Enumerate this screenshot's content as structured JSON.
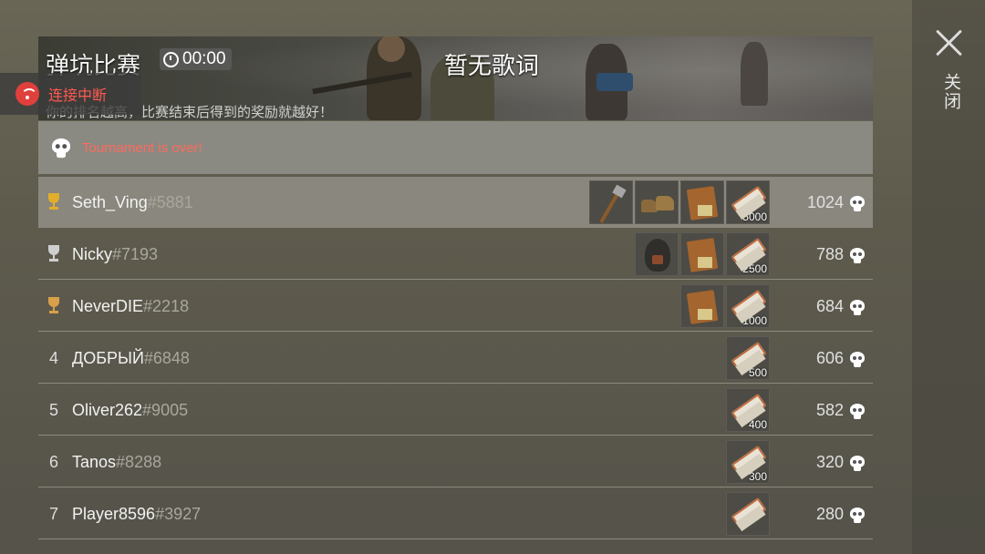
{
  "header": {
    "title": "弹坑比赛",
    "timer": "00:00",
    "lyrics": "暂无歌词",
    "subtitle": "你的排名越高，比赛结束后得到的奖励就越好！"
  },
  "connection": {
    "label": "连接中断"
  },
  "close": {
    "label": "关闭"
  },
  "notice": {
    "text": "Tournament is over!"
  },
  "players": [
    {
      "rank": "",
      "trophy": "gold",
      "name": "Seth_Ving",
      "tag": "#5881",
      "score": "1024",
      "rewards": [
        {
          "item": "axe",
          "qty": ""
        },
        {
          "item": "boots",
          "qty": ""
        },
        {
          "item": "mre",
          "qty": ""
        },
        {
          "item": "ticket",
          "qty": "5000"
        }
      ]
    },
    {
      "rank": "",
      "trophy": "silver",
      "name": "Nicky",
      "tag": "#7193",
      "score": "788",
      "rewards": [
        {
          "item": "mask",
          "qty": ""
        },
        {
          "item": "mre",
          "qty": ""
        },
        {
          "item": "ticket",
          "qty": "2500"
        }
      ]
    },
    {
      "rank": "",
      "trophy": "bronze",
      "name": "NeverDIE",
      "tag": "#2218",
      "score": "684",
      "rewards": [
        {
          "item": "mre",
          "qty": ""
        },
        {
          "item": "ticket",
          "qty": "1000"
        }
      ]
    },
    {
      "rank": "4",
      "trophy": "",
      "name": "ДОБРЫЙ",
      "tag": "#6848",
      "score": "606",
      "rewards": [
        {
          "item": "ticket",
          "qty": "500"
        }
      ]
    },
    {
      "rank": "5",
      "trophy": "",
      "name": "Oliver262",
      "tag": "#9005",
      "score": "582",
      "rewards": [
        {
          "item": "ticket",
          "qty": "400"
        }
      ]
    },
    {
      "rank": "6",
      "trophy": "",
      "name": "Tanos",
      "tag": "#8288",
      "score": "320",
      "rewards": [
        {
          "item": "ticket",
          "qty": "300"
        }
      ]
    },
    {
      "rank": "7",
      "trophy": "",
      "name": "Player8596",
      "tag": "#3927",
      "score": "280",
      "rewards": [
        {
          "item": "ticket",
          "qty": ""
        }
      ]
    }
  ]
}
